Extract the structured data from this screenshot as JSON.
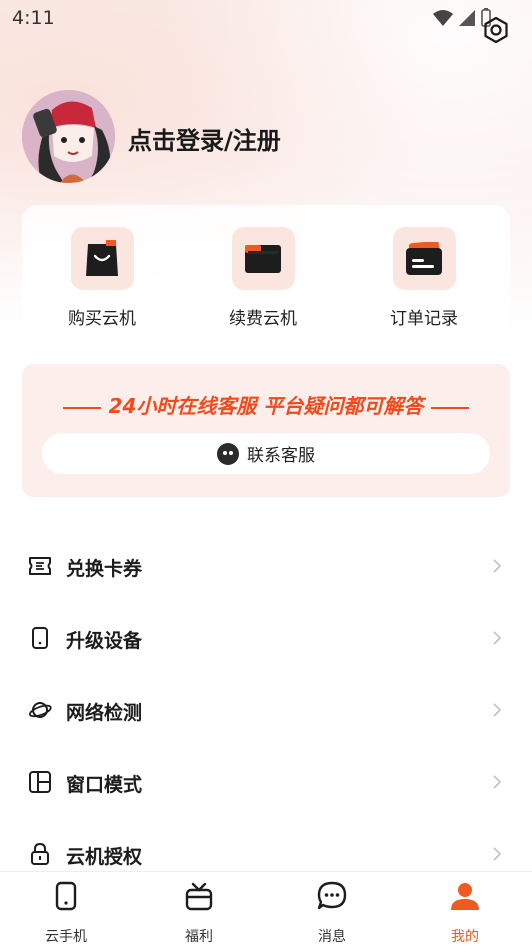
{
  "status_bar": {
    "time": "4:11"
  },
  "profile": {
    "login_label": "点击登录/注册"
  },
  "quick_actions": [
    {
      "label": "购买云机",
      "icon": "shopping-bag-icon"
    },
    {
      "label": "续费云机",
      "icon": "folder-wallet-icon"
    },
    {
      "label": "订单记录",
      "icon": "card-icon"
    }
  ],
  "service": {
    "title": "24小时在线客服 平台疑问都可解答",
    "contact_label": "联系客服"
  },
  "menu": [
    {
      "label": "兑换卡券",
      "icon": "ticket-icon"
    },
    {
      "label": "升级设备",
      "icon": "phone-icon"
    },
    {
      "label": "网络检测",
      "icon": "planet-icon"
    },
    {
      "label": "窗口模式",
      "icon": "window-layout-icon"
    },
    {
      "label": "云机授权",
      "icon": "lock-icon"
    }
  ],
  "bottom_nav": [
    {
      "label": "云手机",
      "icon": "phone-icon"
    },
    {
      "label": "福利",
      "icon": "gift-icon"
    },
    {
      "label": "消息",
      "icon": "chat-icon"
    },
    {
      "label": "我的",
      "icon": "user-icon",
      "active": true
    }
  ],
  "colors": {
    "accent": "#f05a22",
    "banner_text": "#f04a1d",
    "tile_bg": "#fbe6df"
  }
}
